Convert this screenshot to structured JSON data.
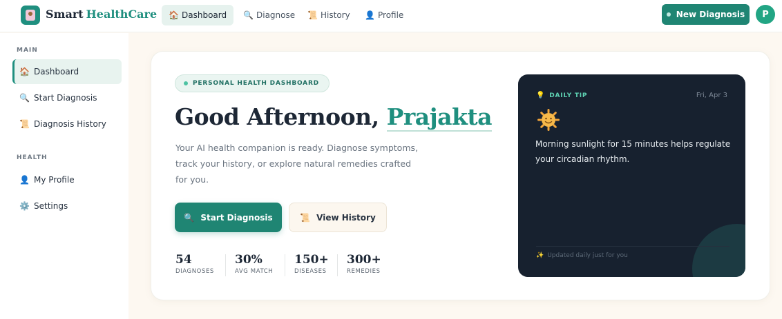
{
  "brand": {
    "name": "Smart",
    "accent": "HealthCare"
  },
  "nav": [
    {
      "label": "Dashboard",
      "icon": "home-icon",
      "active": true
    },
    {
      "label": "Diagnose",
      "icon": "magnifier-icon",
      "active": false
    },
    {
      "label": "History",
      "icon": "scroll-icon",
      "active": false
    },
    {
      "label": "Profile",
      "icon": "person-icon",
      "active": false
    }
  ],
  "header": {
    "new_diagnosis": "New Diagnosis",
    "avatar_initial": "P"
  },
  "sidebar": {
    "main_label": "MAIN",
    "main_items": [
      {
        "label": "Dashboard",
        "icon": "home-icon",
        "active": true
      },
      {
        "label": "Start Diagnosis",
        "icon": "magnifier-icon",
        "active": false
      },
      {
        "label": "Diagnosis History",
        "icon": "scroll-icon",
        "active": false
      }
    ],
    "health_label": "HEALTH",
    "health_items": [
      {
        "label": "My Profile",
        "icon": "person-icon",
        "active": false
      },
      {
        "label": "Settings",
        "icon": "gear-icon",
        "active": false
      }
    ]
  },
  "hero": {
    "badge": "PERSONAL HEALTH DASHBOARD",
    "greeting": "Good Afternoon,",
    "name": "Prajakta",
    "subtitle": "Your AI health companion is ready. Diagnose symptoms, track your history, or explore natural remedies crafted for you.",
    "primary_button": "Start Diagnosis",
    "secondary_button": "View History"
  },
  "stats": [
    {
      "value": "54",
      "label": "DIAGNOSES"
    },
    {
      "value": "30%",
      "label": "AVG MATCH"
    },
    {
      "value": "150+",
      "label": "DISEASES"
    },
    {
      "value": "300+",
      "label": "REMEDIES"
    }
  ],
  "tip": {
    "label": "DAILY TIP",
    "date": "Fri, Apr 3",
    "icon": "sun-emoji",
    "text": "Morning sunlight for 15 minutes helps regulate your circadian rhythm.",
    "footer": "Updated daily just for you"
  },
  "colors": {
    "accent": "#1f8f7f",
    "primary_button": "#1f8573",
    "tip_background": "#17212f",
    "page_background": "#fdf8f1"
  }
}
